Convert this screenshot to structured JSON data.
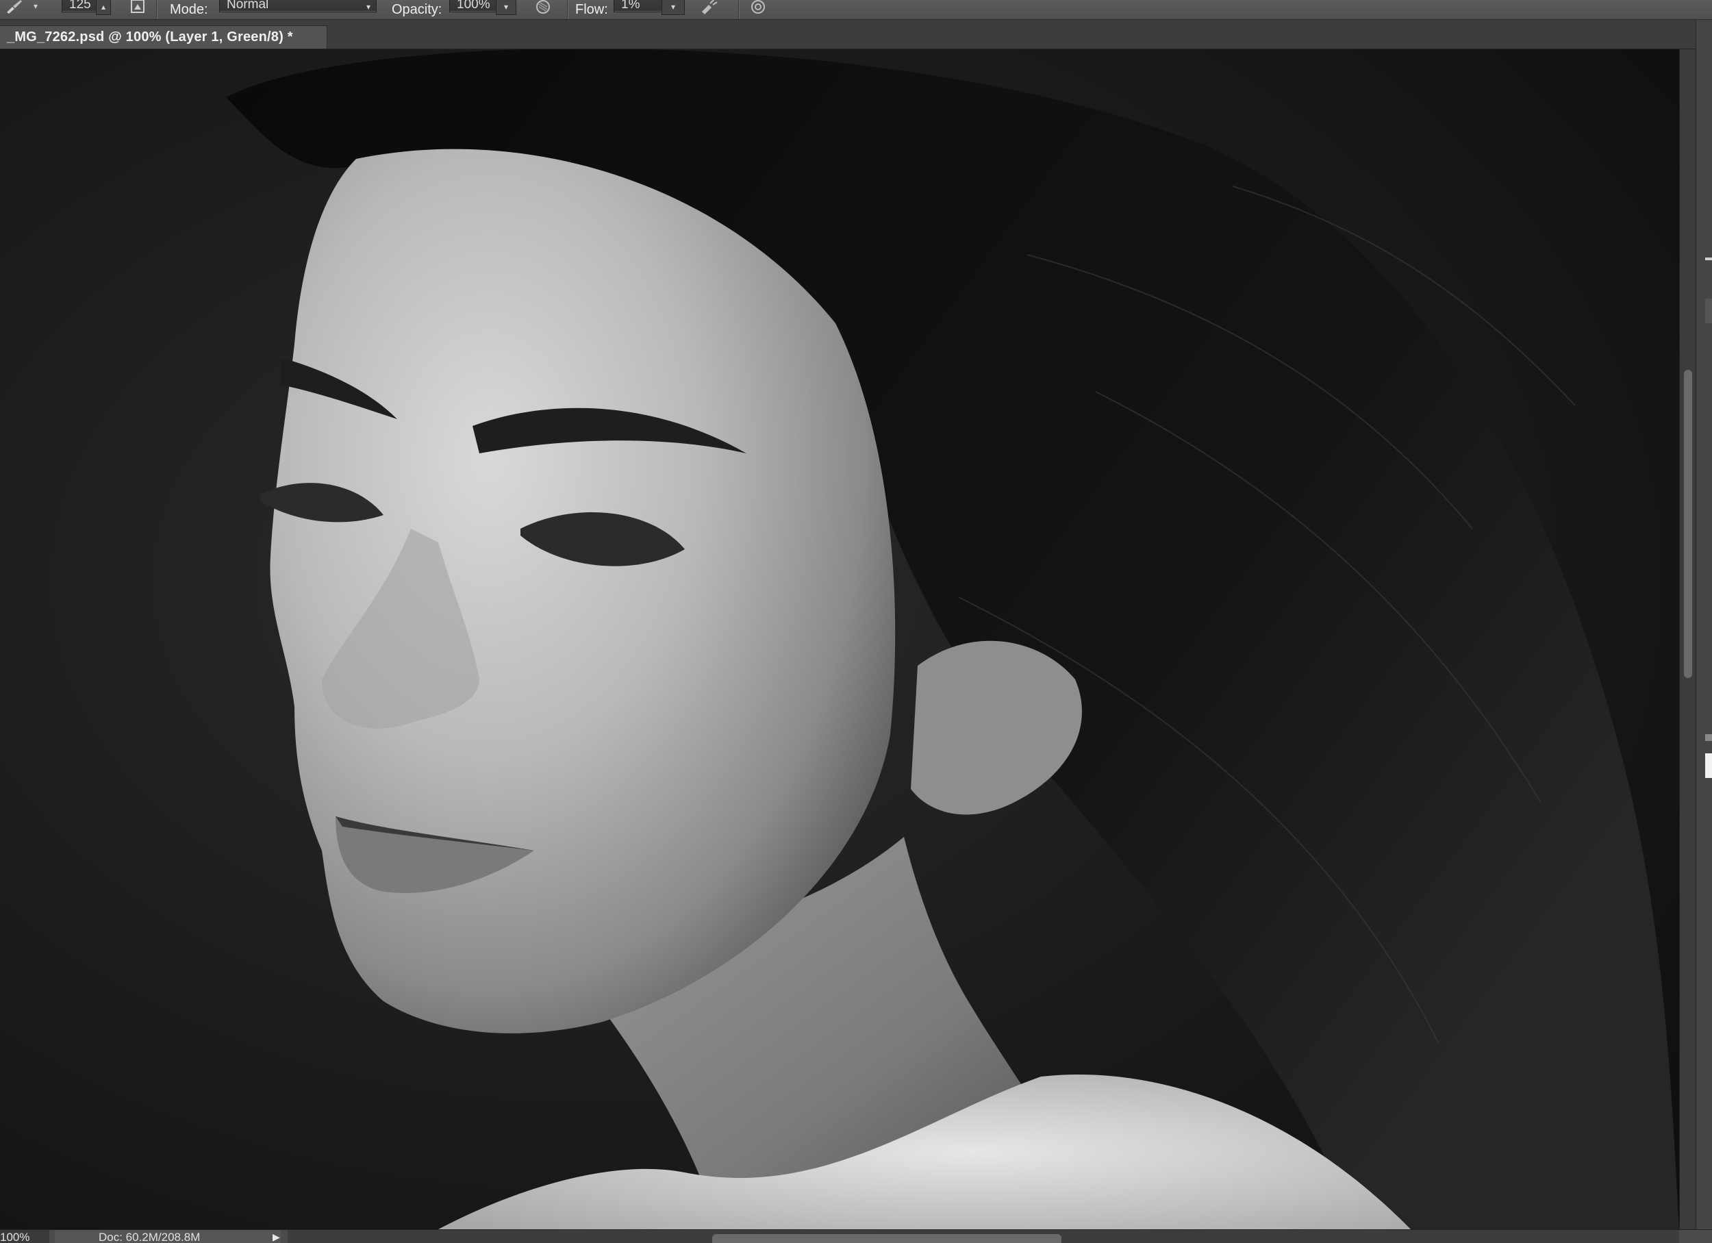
{
  "options_bar": {
    "brush_size": "125",
    "mode_label": "Mode:",
    "mode_value": "Normal",
    "opacity_label": "Opacity:",
    "opacity_value": "100%",
    "flow_label": "Flow:",
    "flow_value": "1%",
    "icons": [
      "brush-icon",
      "brush-panel-toggle-icon",
      "pressure-opacity-icon",
      "airbrush-icon",
      "pressure-size-icon"
    ]
  },
  "document_tab": {
    "title": "_MG_7262.psd @ 100% (Layer 1, Green/8) *"
  },
  "canvas": {
    "content": "black-and-white portrait photograph"
  },
  "status_bar": {
    "zoom": "100%",
    "doc_info": "Doc: 60.2M/208.8M"
  },
  "colors": {
    "options_bar": "#545454",
    "tab_active": "#535353",
    "canvas_bg": "#121212",
    "scroll_thumb": "#6a6a6a"
  }
}
